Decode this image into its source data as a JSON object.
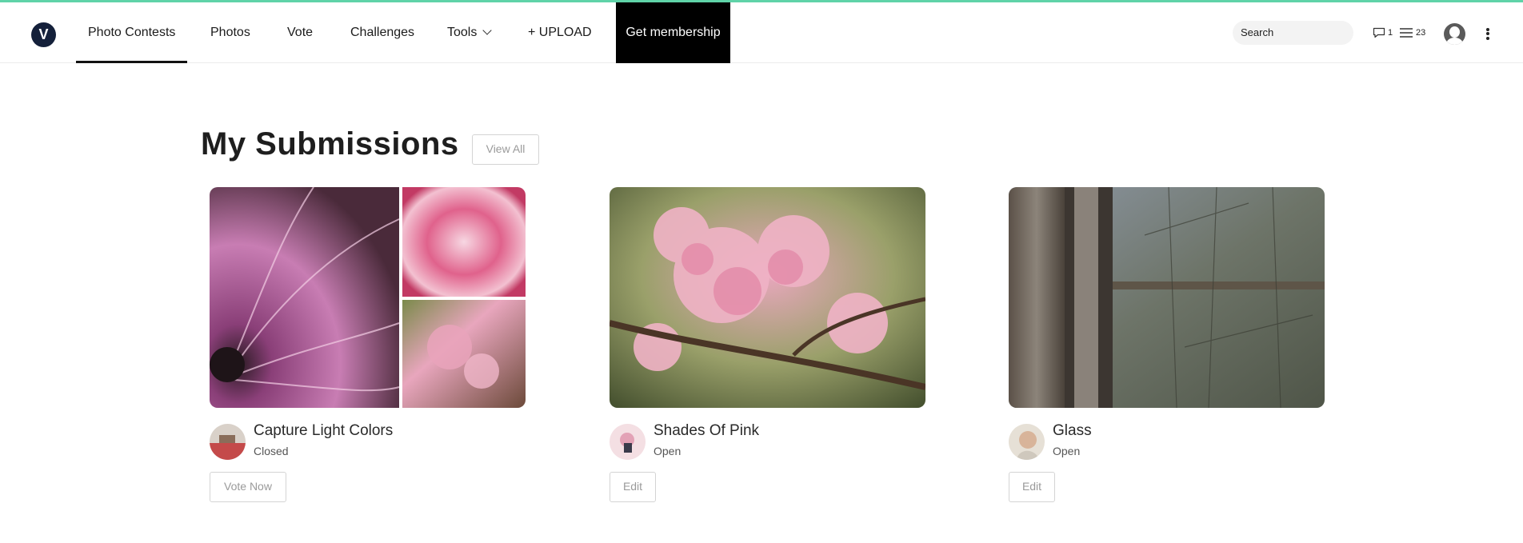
{
  "colors": {
    "accent_line": "#5fd3a8",
    "membership_bg": "#000000",
    "logo_bg": "#14203a"
  },
  "header": {
    "logo_letter": "V",
    "nav": [
      {
        "label": "Photo Contests",
        "active": true
      },
      {
        "label": "Photos"
      },
      {
        "label": "Vote"
      },
      {
        "label": "Challenges"
      },
      {
        "label": "Tools",
        "has_dropdown": true
      },
      {
        "label": "+ UPLOAD"
      }
    ],
    "membership_label": "Get membership",
    "search_placeholder": "Search",
    "messages_count": "1",
    "activity_count": "23",
    "icons": [
      "chat-bubble-icon",
      "list-icon",
      "user-avatar-icon",
      "more-vertical-icon"
    ]
  },
  "main": {
    "title": "My Submissions",
    "view_all_label": "View All",
    "cards": [
      {
        "title": "Capture Light Colors",
        "status": "Closed",
        "button": "Vote Now"
      },
      {
        "title": "Shades Of Pink",
        "status": "Open",
        "button": "Edit"
      },
      {
        "title": "Glass",
        "status": "Open",
        "button": "Edit"
      }
    ]
  }
}
